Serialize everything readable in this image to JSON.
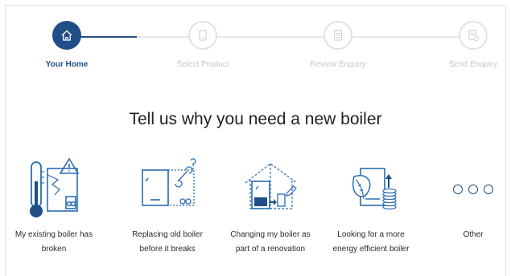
{
  "stepper": {
    "steps": [
      {
        "label": "Your Home",
        "icon": "house-icon",
        "state": "active"
      },
      {
        "label": "Select Product",
        "icon": "boiler-icon",
        "state": "inactive"
      },
      {
        "label": "Review Enquiry",
        "icon": "document-icon",
        "state": "inactive"
      },
      {
        "label": "Send Enquiry",
        "icon": "send-document-icon",
        "state": "inactive"
      }
    ]
  },
  "heading": "Tell us why you need a new boiler",
  "options": [
    {
      "line1": "My existing boiler has",
      "line2": "broken",
      "icon": "broken-boiler-icon"
    },
    {
      "line1": "Replacing old boiler",
      "line2": "before it breaks",
      "icon": "replace-boiler-icon"
    },
    {
      "line1": "Changing my boiler as",
      "line2": "part of a renovation",
      "icon": "renovation-icon"
    },
    {
      "line1": "Looking for a more",
      "line2": "energy efficient boiler",
      "icon": "efficient-boiler-icon"
    },
    {
      "line1": "Other",
      "line2": "",
      "icon": "more-dots-icon"
    }
  ],
  "colors": {
    "accent": "#1f4f86",
    "inactive": "#e2e2e2",
    "icon": "#2a6db3"
  }
}
